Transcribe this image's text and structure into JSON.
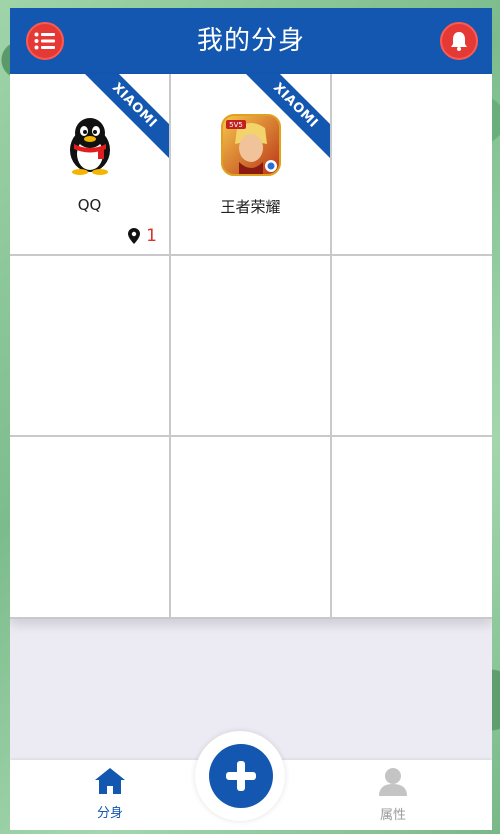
{
  "header": {
    "title": "我的分身",
    "left_icon": "menu-list-icon",
    "right_icon": "bell-icon",
    "accent_color": "#1457b0",
    "button_color": "#e53935"
  },
  "grid": {
    "cells": [
      {
        "app_name": "QQ",
        "icon": "qq-penguin-icon",
        "ribbon": "XIAOMI",
        "location_count": "1"
      },
      {
        "app_name": "王者荣耀",
        "icon": "honor-of-kings-icon",
        "ribbon": "XIAOMI"
      },
      {},
      {},
      {},
      {},
      {},
      {},
      {}
    ]
  },
  "tabs": {
    "home_label": "分身",
    "home_icon": "home-icon",
    "attributes_label": "属性",
    "attributes_icon": "user-icon",
    "add_icon": "plus-icon"
  }
}
